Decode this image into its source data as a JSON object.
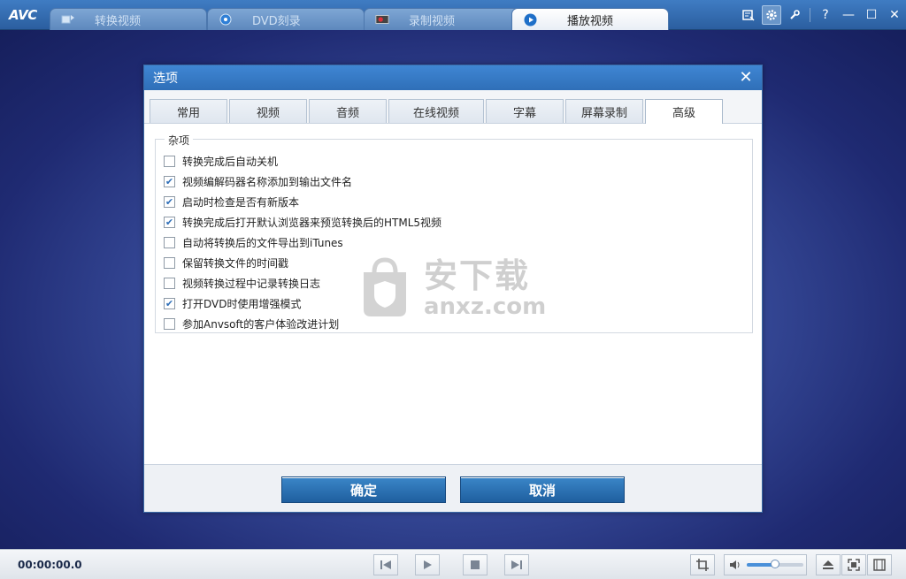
{
  "app": {
    "logo": "AVC",
    "tabs": [
      {
        "label": "转换视频",
        "icon": "convert-video-icon",
        "active": false
      },
      {
        "label": "DVD刻录",
        "icon": "disc-icon",
        "active": false
      },
      {
        "label": "录制视频",
        "icon": "record-video-icon",
        "active": false
      },
      {
        "label": "播放视频",
        "icon": "play-circle-icon",
        "active": true
      }
    ],
    "window_controls": {
      "help": "?",
      "minimize": "—",
      "maximize": "☐",
      "close": "✕"
    }
  },
  "dialog": {
    "title": "选项",
    "close": "✕",
    "tabs": [
      "常用",
      "视频",
      "音频",
      "在线视频",
      "字幕",
      "屏幕录制",
      "高级"
    ],
    "active_tab": "高级",
    "group_title": "杂项",
    "options": [
      {
        "label": "转换完成后自动关机",
        "checked": false
      },
      {
        "label": "视频编解码器名称添加到输出文件名",
        "checked": true
      },
      {
        "label": "启动时检查是否有新版本",
        "checked": true
      },
      {
        "label": "转换完成后打开默认浏览器来预览转换后的HTML5视频",
        "checked": true
      },
      {
        "label": "自动将转换后的文件导出到iTunes",
        "checked": false
      },
      {
        "label": "保留转换文件的时间戳",
        "checked": false
      },
      {
        "label": "视频转换过程中记录转换日志",
        "checked": false
      },
      {
        "label": "打开DVD时使用增强模式",
        "checked": true
      },
      {
        "label": "参加Anvsoft的客户体验改进计划",
        "checked": false
      }
    ],
    "watermark": {
      "main": "安下载",
      "sub": "anxz.com"
    },
    "ok_label": "确定",
    "cancel_label": "取消"
  },
  "player": {
    "timecode": "00:00:00.0",
    "volume_level": 0.5
  },
  "colors": {
    "accent": "#2f6fb8",
    "titlebar": "#3f7cc3",
    "button": "#1f5f9f"
  }
}
